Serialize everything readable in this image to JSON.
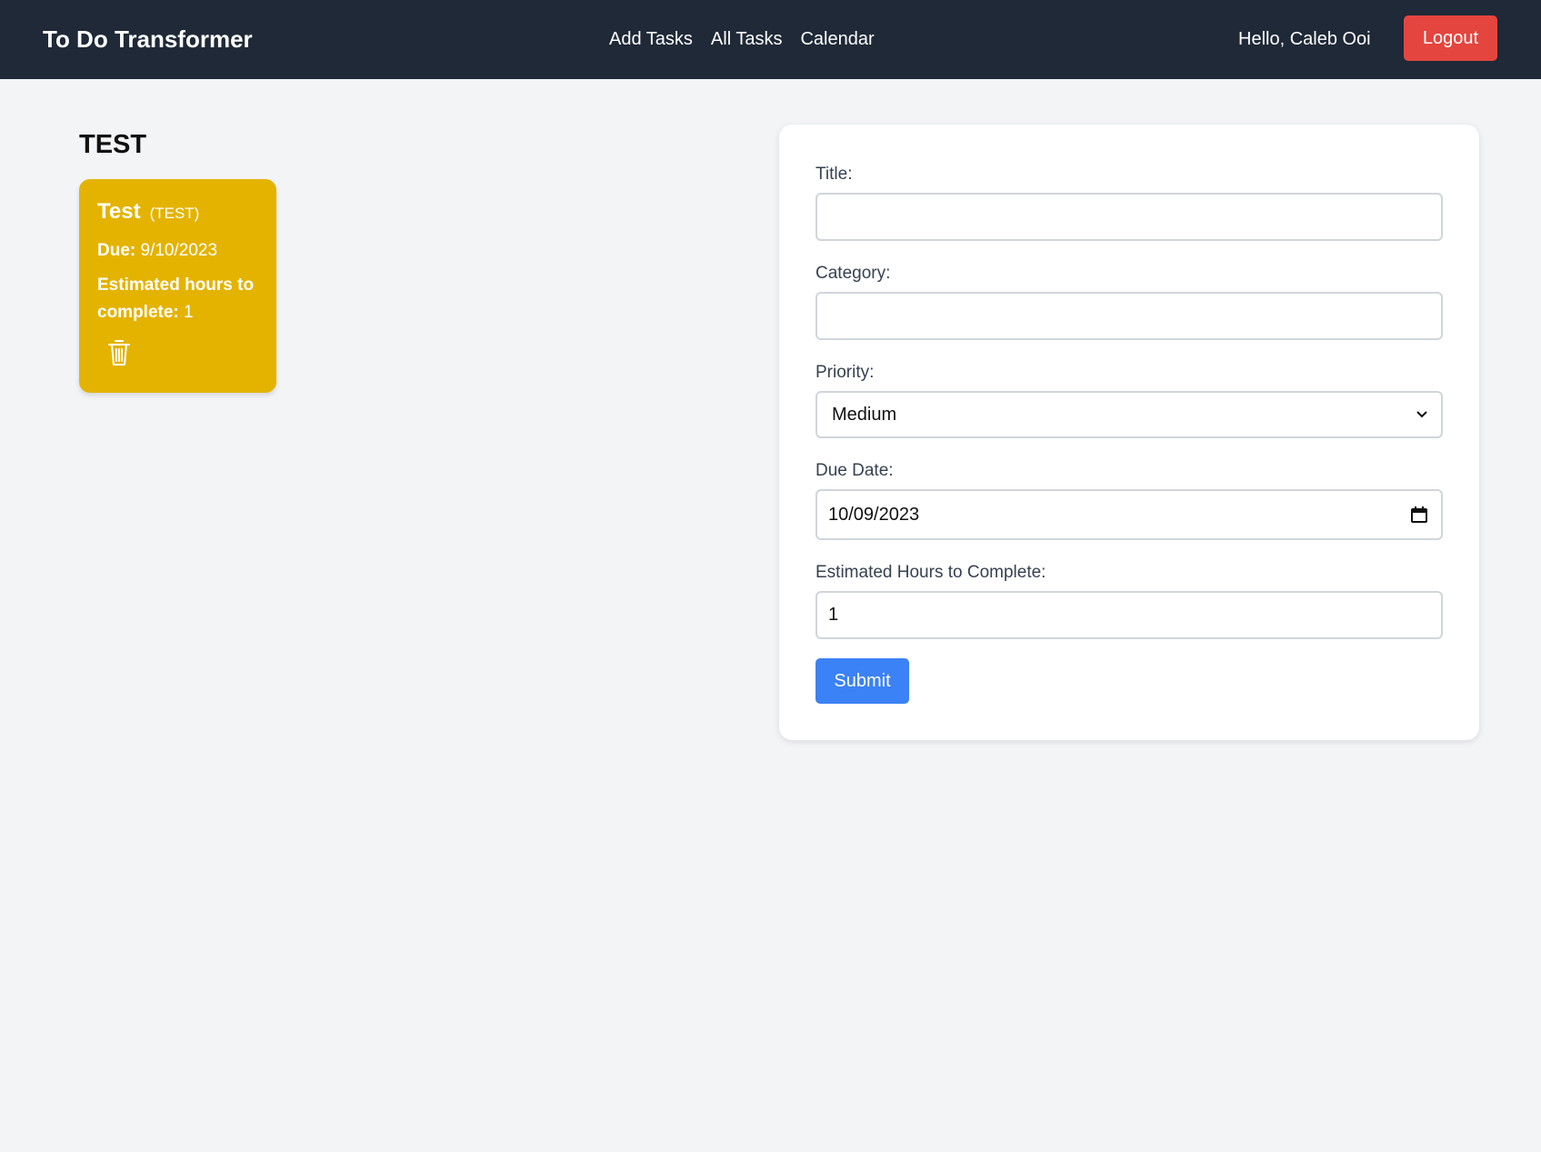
{
  "navbar": {
    "brand": "To Do Transformer",
    "links": [
      "Add Tasks",
      "All Tasks",
      "Calendar"
    ],
    "greeting": "Hello, Caleb Ooi",
    "logout_label": "Logout"
  },
  "category": {
    "heading": "TEST",
    "task": {
      "title": "Test",
      "category_tag": "(TEST)",
      "due_label": "Due:",
      "due_value": "9/10/2023",
      "hours_label": "Estimated hours to complete:",
      "hours_value": "1",
      "icon": "trash-icon"
    }
  },
  "form": {
    "title_label": "Title:",
    "title_value": "",
    "category_label": "Category:",
    "category_value": "",
    "priority_label": "Priority:",
    "priority_value": "Medium",
    "due_label": "Due Date:",
    "due_value": "10/09/2023",
    "hours_label": "Estimated Hours to Complete:",
    "hours_value": "1",
    "submit_label": "Submit"
  },
  "colors": {
    "navbar_bg": "#1f2937",
    "logout_bg": "#e5453f",
    "card_bg": "#e4b300",
    "submit_bg": "#3b82f6",
    "page_bg": "#f3f4f6"
  }
}
